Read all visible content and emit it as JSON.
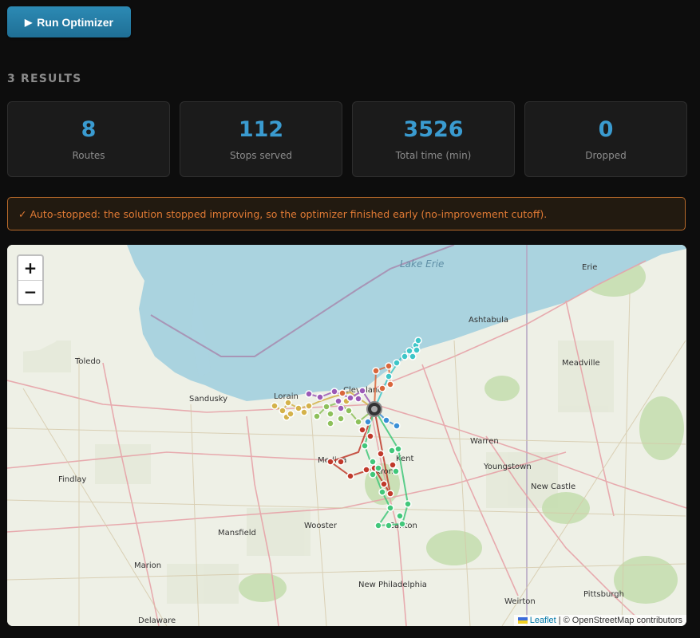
{
  "toolbar": {
    "run_label": "Run Optimizer",
    "run_icon": "play-icon"
  },
  "results": {
    "heading": "3 RESULTS"
  },
  "stats": [
    {
      "value": "8",
      "label": "Routes"
    },
    {
      "value": "112",
      "label": "Stops served"
    },
    {
      "value": "3526",
      "label": "Total time (min)"
    },
    {
      "value": "0",
      "label": "Dropped"
    }
  ],
  "notice": {
    "text": "✓ Auto-stopped: the solution stopped improving, so the optimizer finished early (no-improvement cutoff)."
  },
  "map": {
    "zoom_in": "+",
    "zoom_out": "−",
    "labels": {
      "lake": "Lake Erie",
      "toledo": "Toledo",
      "sandusky": "Sandusky",
      "lorain": "Lorain",
      "cleveland": "Cleveland",
      "ashtabula": "Ashtabula",
      "erie": "Erie",
      "meadville": "Meadville",
      "warren": "Warren",
      "youngstown": "Youngstown",
      "new_castle": "New Castle",
      "kent": "Kent",
      "medina": "Medina",
      "akron": "Akron",
      "canton": "Canton",
      "findlay": "Findlay",
      "mansfield": "Mansfield",
      "wooster": "Wooster",
      "marion": "Marion",
      "new_philadelphia": "New Philadelphia",
      "weirton": "Weirton",
      "pittsburgh": "Pittsburgh",
      "delaware": "Delaware"
    },
    "attribution_link": "Leaflet",
    "attribution_text": "| © OpenStreetMap contributors"
  },
  "colors": {
    "accent": "#3a9bd0",
    "button": "#2a86b0",
    "warning": "#e07a34",
    "route_purple": "#9b59b6",
    "route_yellow": "#d4b24a",
    "route_red": "#c0392b",
    "route_green": "#7fbf4d",
    "route_mint": "#41c77a",
    "route_cyan": "#3ec6c8",
    "route_blue": "#3a8fd6",
    "route_orange": "#d9663b"
  }
}
